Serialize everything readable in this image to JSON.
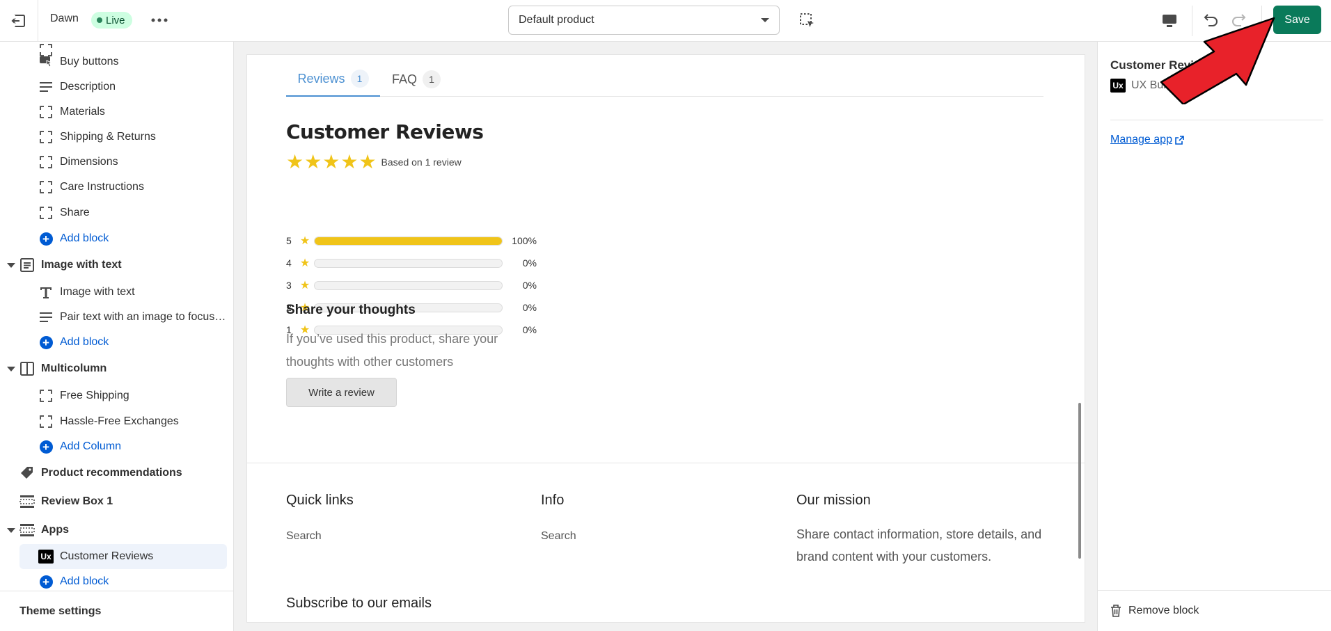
{
  "topbar": {
    "theme_name": "Dawn",
    "live_label": "Live",
    "template_select": "Default product",
    "save_label": "Save"
  },
  "sidebar": {
    "items": [
      {
        "label": "Buy buttons",
        "icon": "buy-button-icon"
      },
      {
        "label": "Description",
        "icon": "text-lines-icon"
      },
      {
        "label": "Materials",
        "icon": "dashed-square-icon"
      },
      {
        "label": "Shipping & Returns",
        "icon": "dashed-square-icon"
      },
      {
        "label": "Dimensions",
        "icon": "dashed-square-icon"
      },
      {
        "label": "Care Instructions",
        "icon": "dashed-square-icon"
      },
      {
        "label": "Share",
        "icon": "dashed-square-icon"
      },
      {
        "label": "Add block",
        "icon": "plus-circle-icon"
      },
      {
        "label": "Image with text",
        "icon": "section-icon"
      },
      {
        "label": "Image with text",
        "icon": "text-t-icon"
      },
      {
        "label": "Pair text with an image to focus on your chosen product, collection, or blog post.",
        "icon": "text-lines-icon"
      },
      {
        "label": "Add block",
        "icon": "plus-circle-icon"
      },
      {
        "label": "Multicolumn",
        "icon": "columns-icon"
      },
      {
        "label": "Free Shipping",
        "icon": "dashed-square-icon"
      },
      {
        "label": "Hassle-Free Exchanges",
        "icon": "dashed-square-icon"
      },
      {
        "label": "Add Column",
        "icon": "plus-circle-icon"
      },
      {
        "label": "Product recommendations",
        "icon": "tag-icon"
      },
      {
        "label": "Review Box 1",
        "icon": "section-dashed-icon"
      },
      {
        "label": "Apps",
        "icon": "section-dashed-icon"
      },
      {
        "label": "Customer Reviews",
        "icon": "ux-bundle-icon"
      },
      {
        "label": "Add block",
        "icon": "plus-circle-icon"
      }
    ],
    "theme_settings": "Theme settings"
  },
  "preview": {
    "tabs": [
      {
        "label": "Reviews",
        "count": "1"
      },
      {
        "label": "FAQ",
        "count": "1"
      }
    ],
    "title": "Customer Reviews",
    "rating_stars": 5,
    "based_on": "Based on 1 review",
    "distribution": [
      {
        "stars": "5",
        "percent_label": "100%",
        "fraction": 1.0
      },
      {
        "stars": "4",
        "percent_label": "0%",
        "fraction": 0
      },
      {
        "stars": "3",
        "percent_label": "0%",
        "fraction": 0
      },
      {
        "stars": "2",
        "percent_label": "0%",
        "fraction": 0
      },
      {
        "stars": "1",
        "percent_label": "0%",
        "fraction": 0
      }
    ],
    "share_title": "Share your thoughts",
    "share_text": "If you’ve used this product, share your thoughts with other customers",
    "write_button": "Write a review",
    "footer": {
      "quick_links": "Quick links",
      "quick_links_item": "Search",
      "info": "Info",
      "info_item": "Search",
      "mission": "Our mission",
      "mission_text": "Share contact information, store details, and brand content with your customers.",
      "subscribe": "Subscribe to our emails"
    }
  },
  "right_panel": {
    "title": "Customer Reviews",
    "app_name": "UX Bundle",
    "manage_app": "Manage app",
    "remove_block": "Remove block"
  },
  "colors": {
    "save": "#0a7a5a",
    "accent_link": "#005bd3",
    "star": "#f0c419",
    "tab_active": "#4a8fd1",
    "annotation_arrow": "#e8222a"
  }
}
